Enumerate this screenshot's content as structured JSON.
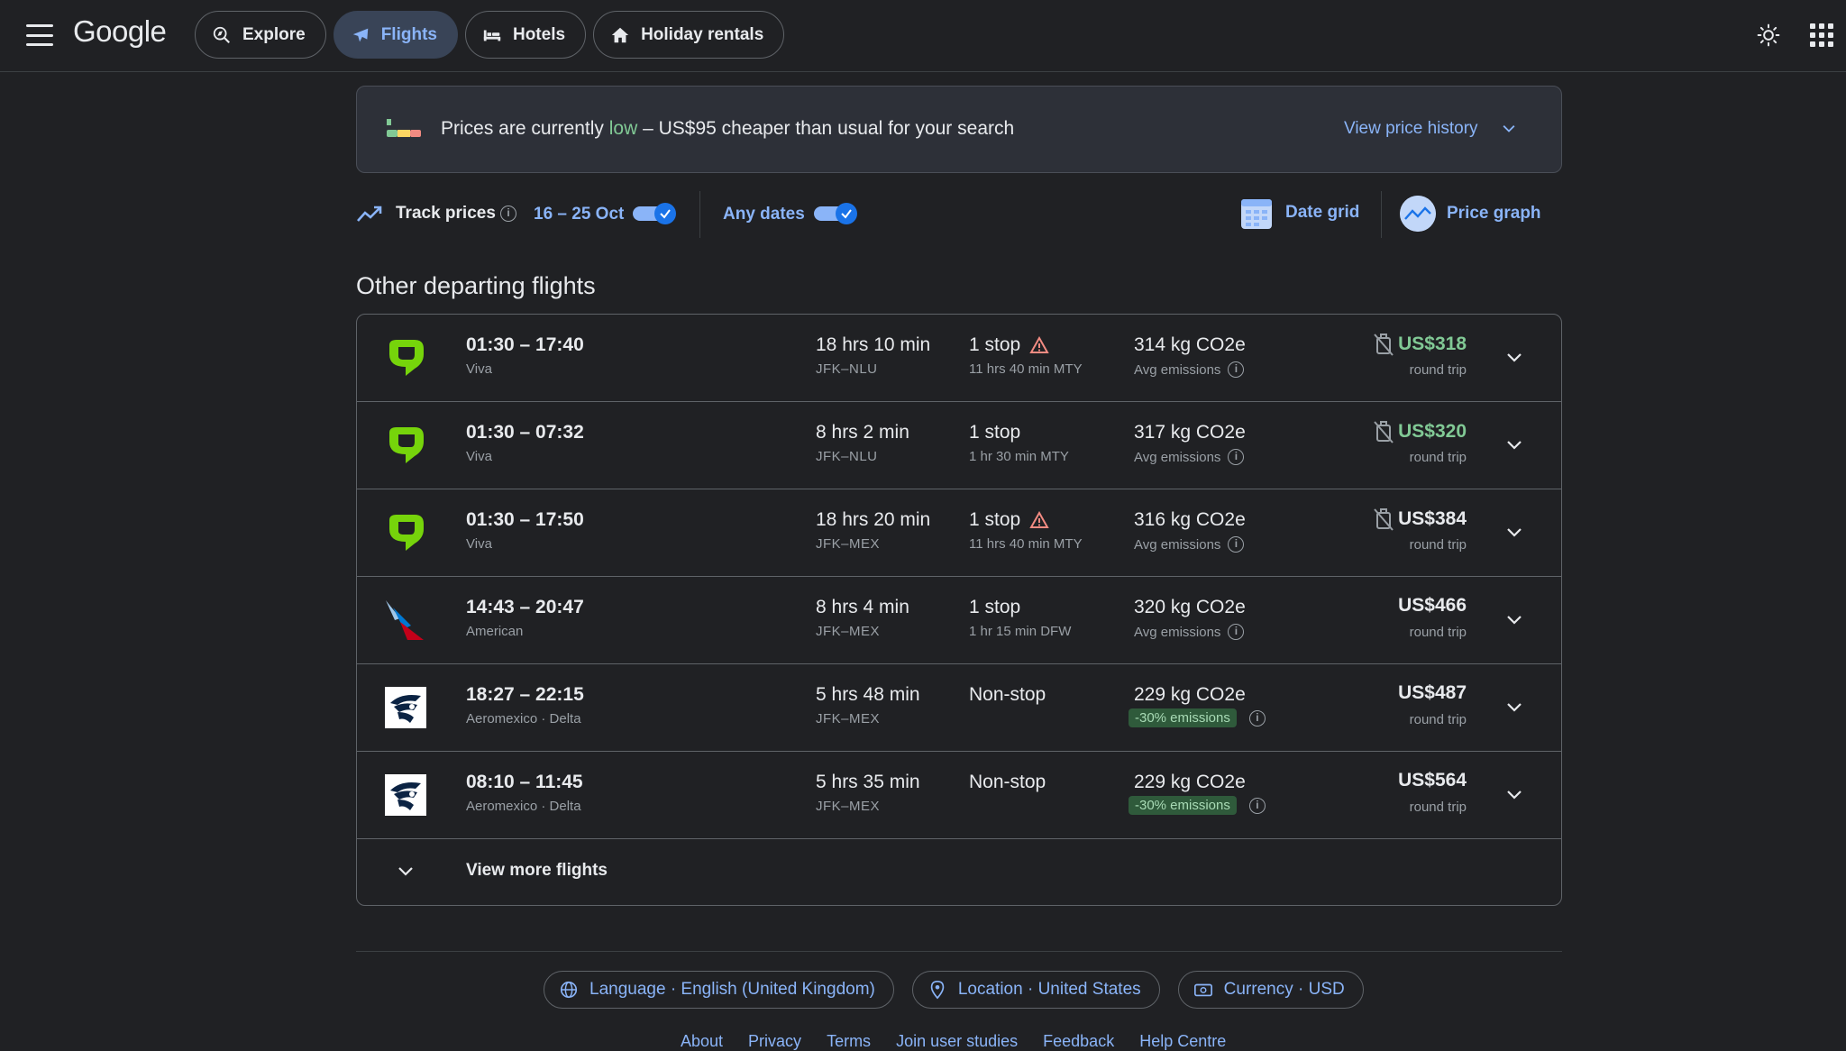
{
  "header": {
    "logo": "Google",
    "tabs": [
      {
        "label": "Explore",
        "icon": "explore-icon"
      },
      {
        "label": "Flights",
        "icon": "plane-icon",
        "active": true
      },
      {
        "label": "Hotels",
        "icon": "bed-icon"
      },
      {
        "label": "Holiday rentals",
        "icon": "house-icon"
      }
    ]
  },
  "banner": {
    "text_prefix": "Prices are currently ",
    "text_low": "low",
    "text_suffix": " – US$95 cheaper than usual for your search",
    "history_link": "View price history"
  },
  "track": {
    "label": "Track prices",
    "dates": "16 – 25 Oct",
    "any_dates": "Any dates",
    "date_grid": "Date grid",
    "price_graph": "Price graph"
  },
  "section_title": "Other departing flights",
  "flights": [
    {
      "times": "01:30 – 17:40",
      "carrier": "Viva",
      "duration": "18 hrs 10 min",
      "route": "JFK–NLU",
      "stops": "1 stop",
      "warning": true,
      "layover": "11 hrs 40 min MTY",
      "emissions": "314 kg CO2e",
      "em_label": "Avg emissions",
      "price": "US$318",
      "price_green": true,
      "no_bag": true,
      "price_sub": "round trip",
      "logo": "viva"
    },
    {
      "times": "01:30 – 07:32",
      "carrier": "Viva",
      "duration": "8 hrs 2 min",
      "route": "JFK–NLU",
      "stops": "1 stop",
      "warning": false,
      "layover": "1 hr 30 min MTY",
      "emissions": "317 kg CO2e",
      "em_label": "Avg emissions",
      "price": "US$320",
      "price_green": true,
      "no_bag": true,
      "price_sub": "round trip",
      "logo": "viva"
    },
    {
      "times": "01:30 – 17:50",
      "carrier": "Viva",
      "duration": "18 hrs 20 min",
      "route": "JFK–MEX",
      "stops": "1 stop",
      "warning": true,
      "layover": "11 hrs 40 min MTY",
      "emissions": "316 kg CO2e",
      "em_label": "Avg emissions",
      "price": "US$384",
      "price_green": false,
      "no_bag": true,
      "price_sub": "round trip",
      "logo": "viva"
    },
    {
      "times": "14:43 – 20:47",
      "carrier": "American",
      "duration": "8 hrs 4 min",
      "route": "JFK–MEX",
      "stops": "1 stop",
      "warning": false,
      "layover": "1 hr 15 min DFW",
      "emissions": "320 kg CO2e",
      "em_label": "Avg emissions",
      "price": "US$466",
      "price_green": false,
      "no_bag": false,
      "price_sub": "round trip",
      "logo": "american"
    },
    {
      "times": "18:27 – 22:15",
      "carrier": "Aeromexico · Delta",
      "duration": "5 hrs 48 min",
      "route": "JFK–MEX",
      "stops": "Non-stop",
      "warning": false,
      "layover": "",
      "emissions": "229 kg CO2e",
      "em_badge": "-30% emissions",
      "price": "US$487",
      "price_green": false,
      "no_bag": false,
      "price_sub": "round trip",
      "logo": "aeromexico"
    },
    {
      "times": "08:10 – 11:45",
      "carrier": "Aeromexico · Delta",
      "duration": "5 hrs 35 min",
      "route": "JFK–MEX",
      "stops": "Non-stop",
      "warning": false,
      "layover": "",
      "emissions": "229 kg CO2e",
      "em_badge": "-30% emissions",
      "price": "US$564",
      "price_green": false,
      "no_bag": false,
      "price_sub": "round trip",
      "logo": "aeromexico"
    }
  ],
  "view_more": "View more flights",
  "footer": {
    "language": "Language · English (United Kingdom)",
    "location": "Location · United States",
    "currency": "Currency · USD",
    "links": [
      "About",
      "Privacy",
      "Terms",
      "Join user studies",
      "Feedback",
      "Help Centre"
    ]
  },
  "colors": {
    "accent": "#8ab4f8",
    "green": "#81c995",
    "background": "#202124"
  }
}
